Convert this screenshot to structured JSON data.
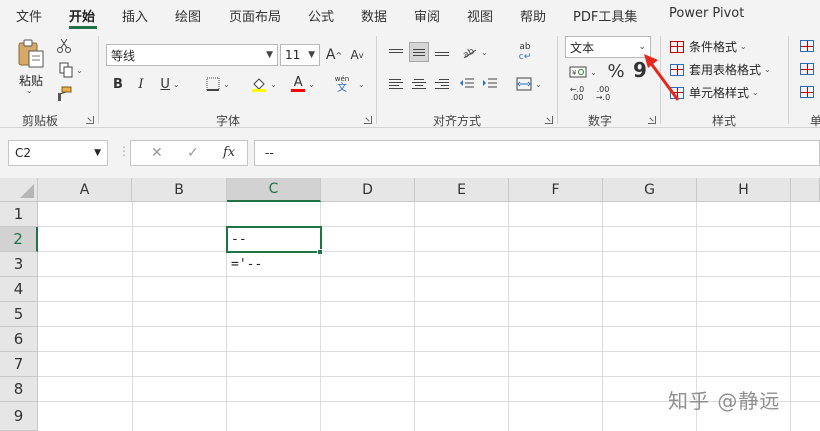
{
  "ribbon_tabs": {
    "file": "文件",
    "home": "开始",
    "insert": "插入",
    "draw": "绘图",
    "page_layout": "页面布局",
    "formulas": "公式",
    "data": "数据",
    "review": "审阅",
    "view": "视图",
    "help": "帮助",
    "pdf_tools": "PDF工具集",
    "power_pivot": "Power Pivot"
  },
  "clipboard": {
    "paste_label": "粘贴",
    "group_label": "剪贴板"
  },
  "font": {
    "font_name": "等线",
    "font_size": "11",
    "bold": "B",
    "italic": "I",
    "underline": "U",
    "phonetic_top": "wén",
    "phonetic_bottom": "文",
    "font_color_letter": "A",
    "grow": "A",
    "shrink": "A",
    "group_label": "字体",
    "highlight_color": "#ffff00",
    "font_color": "#ff0000"
  },
  "alignment": {
    "group_label": "对齐方式"
  },
  "number": {
    "format_value": "文本",
    "percent": "%",
    "comma": "9",
    "group_label": "数字"
  },
  "styles": {
    "conditional_formatting": "条件格式",
    "format_as_table": "套用表格格式",
    "cell_styles": "单元格样式",
    "group_label": "样式"
  },
  "next_group_label_partial": "单",
  "formula_bar": {
    "name_box": "C2",
    "fx": "fx",
    "formula": "--"
  },
  "sheet": {
    "columns": [
      "A",
      "B",
      "C",
      "D",
      "E",
      "F",
      "G",
      "H"
    ],
    "rows": [
      "1",
      "2",
      "3",
      "4",
      "5",
      "6",
      "7",
      "8",
      "9"
    ],
    "cells": {
      "C2": "--",
      "C3": "='--"
    },
    "active_cell": "C2",
    "accent_color": "#217346"
  },
  "watermark": "知乎 @静远",
  "annotation_color": "#e8261c"
}
